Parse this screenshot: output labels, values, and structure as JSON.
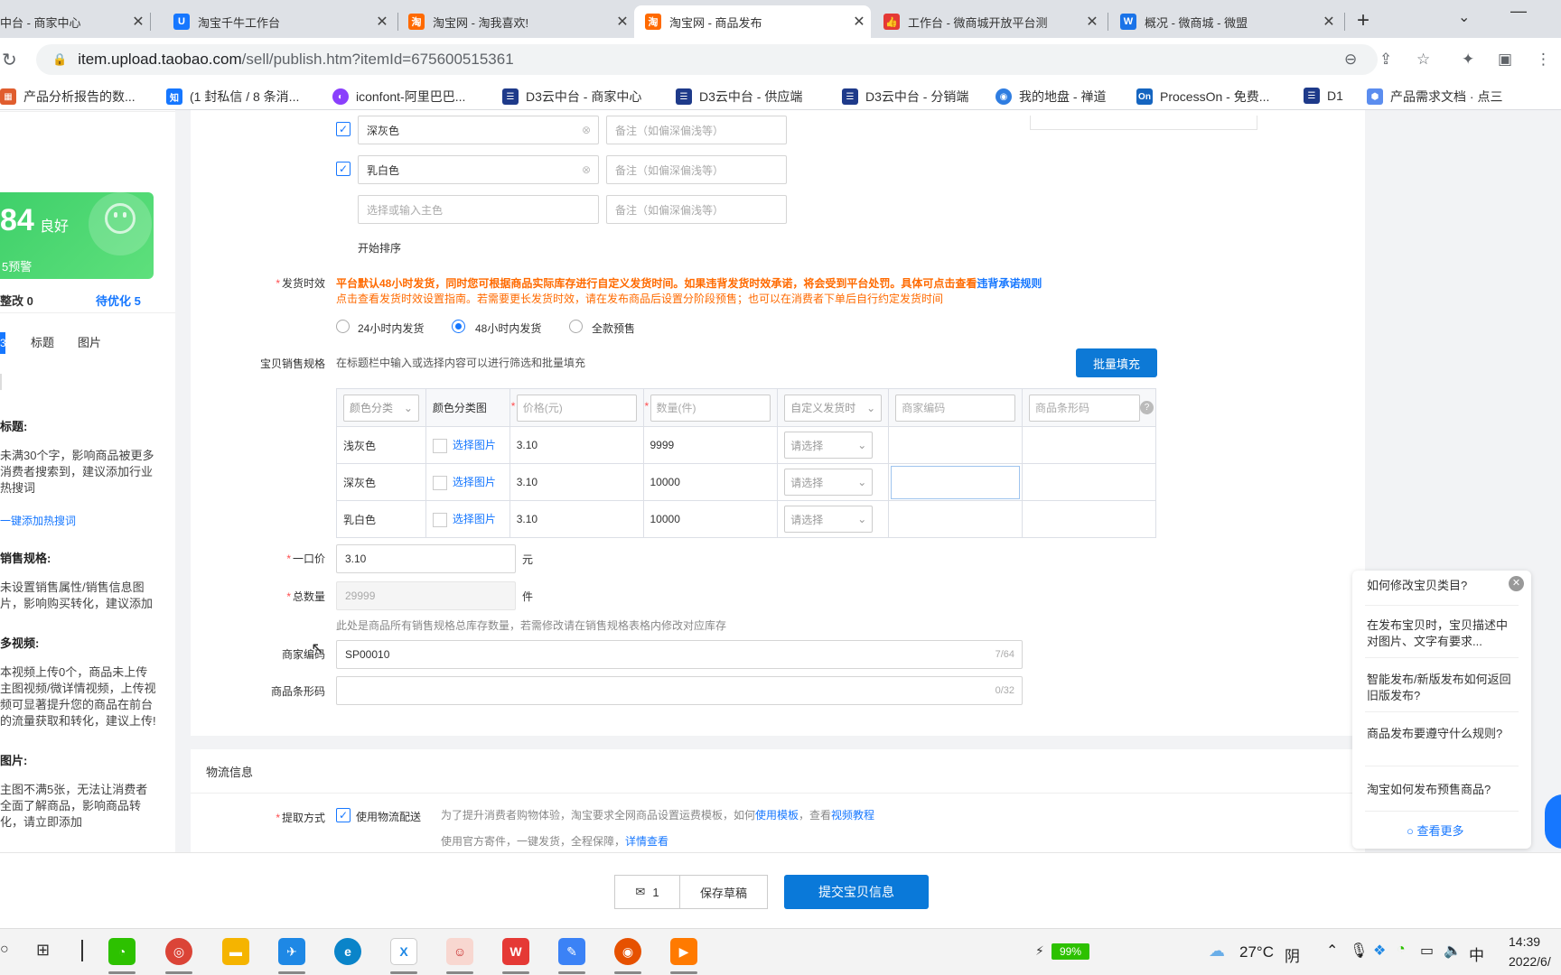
{
  "tabs": [
    {
      "label": "中台 - 商家中心",
      "color": "#e8a33d",
      "glyph": "D"
    },
    {
      "label": "淘宝千牛工作台",
      "color": "#1677ff",
      "glyph": "U"
    },
    {
      "label": "淘宝网 - 淘我喜欢!",
      "color": "#ff6a00",
      "glyph": "淘"
    },
    {
      "label": "淘宝网 - 商品发布",
      "color": "#ff6a00",
      "glyph": "淘"
    },
    {
      "label": "工作台 - 微商城开放平台测",
      "color": "#e53935",
      "glyph": "👍"
    },
    {
      "label": "概况 - 微商城 - 微盟",
      "color": "#1a73e8",
      "glyph": "W"
    }
  ],
  "address": {
    "host": "item.upload.taobao.com",
    "path": "/sell/publish.htm?itemId=675600515361"
  },
  "bookmarks": [
    {
      "label": "产品分析报告的数...",
      "color": "#e05d2e",
      "glyph": "▦"
    },
    {
      "label": "(1 封私信 / 8 条消...",
      "color": "#1677ff",
      "glyph": "知"
    },
    {
      "label": "iconfont-阿里巴巴...",
      "color": "#8a3ffc",
      "glyph": "◐"
    },
    {
      "label": "D3云中台 - 商家中心",
      "color": "#1e3a8a",
      "glyph": "☰"
    },
    {
      "label": "D3云中台 - 供应端",
      "color": "#1e3a8a",
      "glyph": "☰"
    },
    {
      "label": "D3云中台 - 分销端",
      "color": "#1e3a8a",
      "glyph": "☰"
    },
    {
      "label": "我的地盘 - 禅道",
      "color": "#2f7de1",
      "glyph": "◉"
    },
    {
      "label": "ProcessOn - 免费...",
      "color": "#1565c0",
      "glyph": "On"
    },
    {
      "label": "D1",
      "color": "#1e3a8a",
      "glyph": "☰"
    },
    {
      "label": "产品需求文档 · 点三",
      "color": "#5b8def",
      "glyph": "⬢"
    }
  ],
  "left": {
    "score": "84",
    "score_grade": "良好",
    "warn": "5预警",
    "rectify_label": "整改",
    "rectify_count": "0",
    "optimize_label": "待优化",
    "optimize_count": "5",
    "tab_title": "标题",
    "tab_image": "图片",
    "tab_active": "3",
    "sec1_title": "标题:",
    "sec1_text": "未满30个字，影响商品被更多消费者搜索到，建议添加行业热搜词",
    "sec1_link": "一键添加热搜词",
    "sec2_title": "销售规格:",
    "sec2_text": "未设置销售属性/销售信息图片，影响购买转化，建议添加",
    "sec3_title": "多视频:",
    "sec3_text": "本视频上传0个，商品未上传主图视频/微详情视频，上传视频可显著提升您的商品在前台的流量获取和转化，建议上传!",
    "sec4_title": "图片:",
    "sec4_text": "主图不满5张，无法让消费者全面了解商品，影响商品转化，请立即添加"
  },
  "colors": {
    "row1": {
      "value": "深灰色",
      "note_ph": "备注（如偏深偏浅等）"
    },
    "row2": {
      "value": "乳白色",
      "note_ph": "备注（如偏深偏浅等）"
    },
    "row3": {
      "ph": "选择或输入主色",
      "note_ph": "备注（如偏深偏浅等）"
    },
    "sort": "开始排序"
  },
  "ship": {
    "label": "发货时效",
    "warn": "平台默认48小时发货，同时您可根据商品实际库存进行自定义发货时间。如果违背发货时效承诺，将会受到平台处罚。具体可点击查看",
    "warn_link": "违背承诺规则",
    "hint": "点击查看发货时效设置指南。若需要更长发货时效，请在发布商品后设置分阶段预售；也可以在消费者下单后自行约定发货时间",
    "opt1": "24小时内发货",
    "opt2": "48小时内发货",
    "opt3": "全款预售"
  },
  "spec": {
    "label": "宝贝销售规格",
    "hint": "在标题栏中输入或选择内容可以进行筛选和批量填充",
    "batch": "批量填充",
    "h_color": "颜色分类",
    "h_colorimg": "颜色分类图",
    "h_price": "价格(元)",
    "h_qty": "数量(件)",
    "h_ship": "自定义发货时",
    "h_code": "商家编码",
    "h_barcode": "商品条形码",
    "pick_img": "选择图片",
    "select_ph": "请选择",
    "rows": [
      {
        "color": "浅灰色",
        "price": "3.10",
        "qty": "9999"
      },
      {
        "color": "深灰色",
        "price": "3.10",
        "qty": "10000"
      },
      {
        "color": "乳白色",
        "price": "3.10",
        "qty": "10000"
      }
    ]
  },
  "price": {
    "label": "一口价",
    "value": "3.10",
    "unit": "元"
  },
  "total": {
    "label": "总数量",
    "value": "29999",
    "unit": "件",
    "hint": "此处是商品所有销售规格总库存数量，若需修改请在销售规格表格内修改对应库存"
  },
  "code": {
    "label": "商家编码",
    "value": "SP00010",
    "count": "7/64"
  },
  "barcode": {
    "label": "商品条形码",
    "value": "",
    "count": "0/32"
  },
  "logistics": {
    "section": "物流信息",
    "label": "提取方式",
    "check": "使用物流配送",
    "hint1": "为了提升消费者购物体验，淘宝要求全网商品设置运费模板，如何",
    "hint1_link1": "使用模板",
    "hint1_mid": "，查看",
    "hint1_link2": "视频教程",
    "hint2": "使用官方寄件，一键发货，全程保障，",
    "hint2_link": "详情查看"
  },
  "help": {
    "q1": "如何修改宝贝类目?",
    "q2": "在发布宝贝时，宝贝描述中对图片、文字有要求...",
    "q3": "智能发布/新版发布如何返回旧版发布?",
    "q4": "商品发布要遵守什么规则?",
    "q5": "淘宝如何发布预售商品?",
    "more": "查看更多"
  },
  "bottom": {
    "msg_count": "1",
    "save": "保存草稿",
    "submit": "提交宝贝信息"
  },
  "taskbar": {
    "battery": "99%",
    "temp": "27°C",
    "weather": "阴",
    "ime": "中",
    "time": "14:39",
    "date": "2022/6/"
  }
}
